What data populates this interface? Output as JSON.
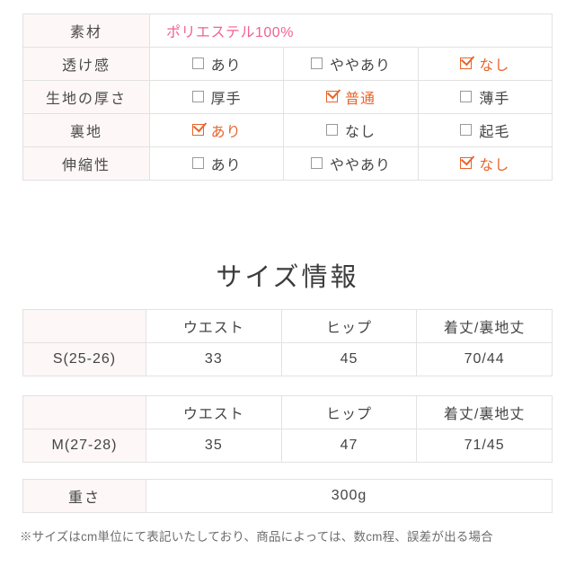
{
  "spec": {
    "rows": [
      {
        "label": "素材",
        "type": "text",
        "value": "ポリエステル100%",
        "value_color": "#f06292"
      },
      {
        "label": "透け感",
        "type": "options",
        "options": [
          {
            "text": "あり",
            "checked": false
          },
          {
            "text": "ややあり",
            "checked": false
          },
          {
            "text": "なし",
            "checked": true
          }
        ]
      },
      {
        "label": "生地の厚さ",
        "type": "options",
        "options": [
          {
            "text": "厚手",
            "checked": false
          },
          {
            "text": "普通",
            "checked": true
          },
          {
            "text": "薄手",
            "checked": false
          }
        ]
      },
      {
        "label": "裏地",
        "type": "options",
        "options": [
          {
            "text": "あり",
            "checked": true
          },
          {
            "text": "なし",
            "checked": false
          },
          {
            "text": "起毛",
            "checked": false
          }
        ]
      },
      {
        "label": "伸縮性",
        "type": "options",
        "options": [
          {
            "text": "あり",
            "checked": false
          },
          {
            "text": "ややあり",
            "checked": false
          },
          {
            "text": "なし",
            "checked": true
          }
        ]
      }
    ]
  },
  "size_section": {
    "heading": "サイズ情報",
    "tables": [
      {
        "corner": "",
        "headers": [
          "ウエスト",
          "ヒップ",
          "着丈/裏地丈"
        ],
        "row_label": "S(25-26)",
        "values": [
          "33",
          "45",
          "70/44"
        ]
      },
      {
        "corner": "",
        "headers": [
          "ウエスト",
          "ヒップ",
          "着丈/裏地丈"
        ],
        "row_label": "M(27-28)",
        "values": [
          "35",
          "47",
          "71/45"
        ]
      }
    ]
  },
  "weight": {
    "label": "重さ",
    "value": "300g"
  },
  "note": {
    "text": "※サイズはcm単位にて表記いたしており、商品によっては、数cm程、誤差が出る場合"
  }
}
